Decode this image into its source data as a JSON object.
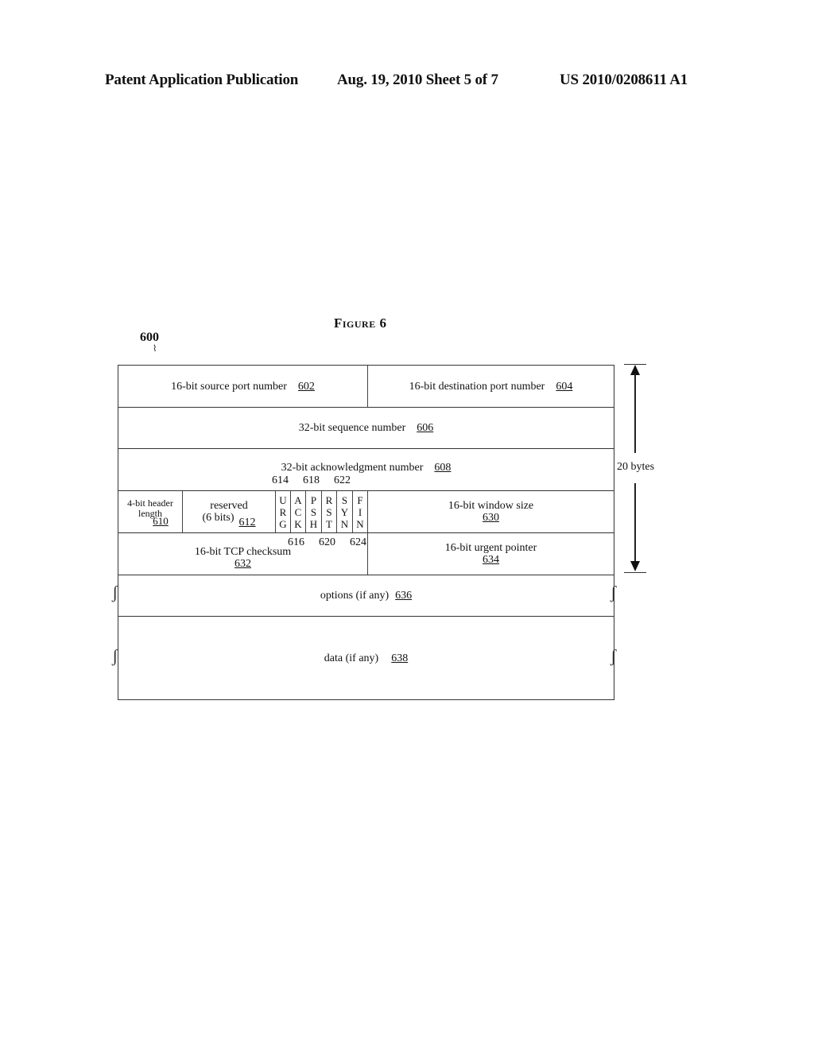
{
  "header": {
    "left": "Patent Application Publication",
    "middle": "Aug. 19, 2010  Sheet 5 of 7",
    "right": "US 2010/0208611 A1"
  },
  "figure": {
    "title": "Figure 6",
    "ref": "600",
    "size_label": "20 bytes",
    "rows": {
      "r1": {
        "left": {
          "label": "16-bit source port number",
          "ref": "602"
        },
        "right": {
          "label": "16-bit destination port number",
          "ref": "604"
        }
      },
      "r2": {
        "label": "32-bit sequence number",
        "ref": "606"
      },
      "r3": {
        "label": "32-bit acknowledgment number",
        "ref": "608"
      },
      "r4": {
        "header_length": {
          "line1": "4-bit header",
          "line2": "length",
          "ref": "610"
        },
        "reserved": {
          "line1": "reserved",
          "line2": "(6 bits)",
          "ref": "612"
        },
        "flags": [
          {
            "chars": [
              "U",
              "R",
              "G"
            ]
          },
          {
            "chars": [
              "A",
              "C",
              "K"
            ]
          },
          {
            "chars": [
              "P",
              "S",
              "H"
            ]
          },
          {
            "chars": [
              "R",
              "S",
              "T"
            ]
          },
          {
            "chars": [
              "S",
              "Y",
              "N"
            ]
          },
          {
            "chars": [
              "F",
              "I",
              "N"
            ]
          }
        ],
        "flag_refs_top": [
          "614",
          "618",
          "622"
        ],
        "flag_refs_bottom": [
          "616",
          "620",
          "624"
        ],
        "window": {
          "label": "16-bit window size",
          "ref": "630"
        }
      },
      "r5": {
        "checksum": {
          "label": "16-bit TCP checksum",
          "ref": "632"
        },
        "urgent": {
          "label": "16-bit urgent pointer",
          "ref": "634"
        }
      },
      "r6": {
        "label": "options (if any)",
        "ref": "636"
      },
      "r7": {
        "label": "data (if any)",
        "ref": "638"
      }
    }
  }
}
